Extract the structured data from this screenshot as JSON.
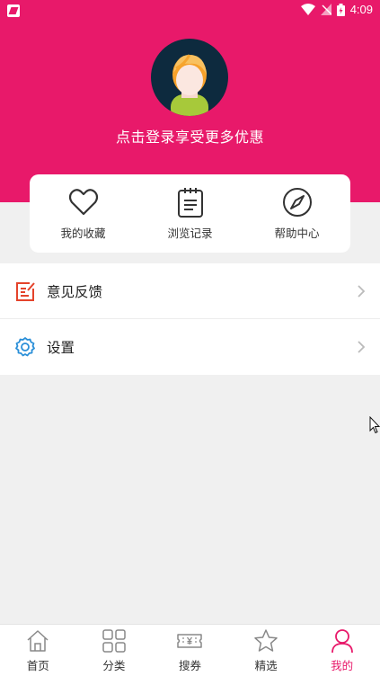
{
  "status_bar": {
    "time": "4:09"
  },
  "profile": {
    "login_prompt": "点击登录享受更多优惠"
  },
  "quick_actions": [
    {
      "label": "我的收藏",
      "icon": "heart-icon"
    },
    {
      "label": "浏览记录",
      "icon": "clipboard-icon"
    },
    {
      "label": "帮助中心",
      "icon": "compass-icon"
    }
  ],
  "menu": [
    {
      "label": "意见反馈",
      "icon": "edit-icon",
      "color": "#e4432b"
    },
    {
      "label": "设置",
      "icon": "gear-icon",
      "color": "#2a8fd8"
    }
  ],
  "tabs": [
    {
      "label": "首页",
      "icon": "home-icon"
    },
    {
      "label": "分类",
      "icon": "grid-icon"
    },
    {
      "label": "搜券",
      "icon": "coupon-icon"
    },
    {
      "label": "精选",
      "icon": "star-icon"
    },
    {
      "label": "我的",
      "icon": "user-icon",
      "active": true
    }
  ],
  "colors": {
    "brand": "#e8196a",
    "background": "#f0f0f0"
  }
}
